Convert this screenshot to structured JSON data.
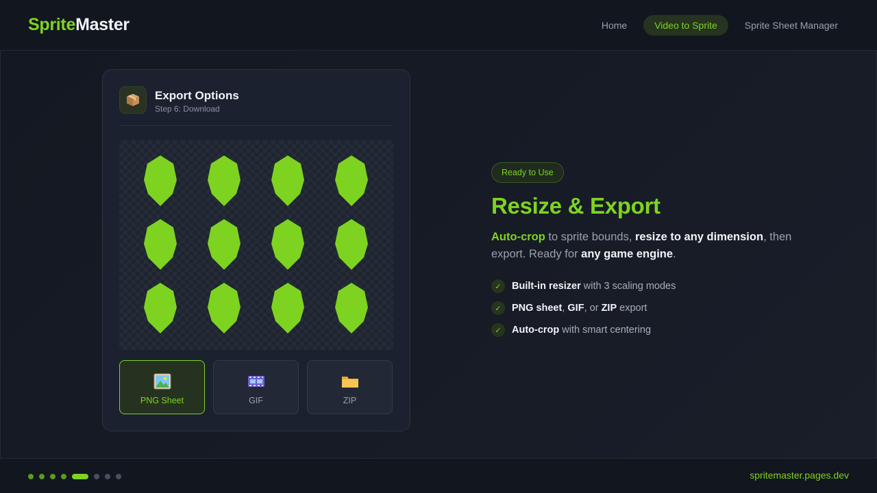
{
  "header": {
    "logo_part1": "Sprite",
    "logo_part2": "Master",
    "nav": [
      {
        "label": "Home",
        "active": false
      },
      {
        "label": "Video to Sprite",
        "active": true
      },
      {
        "label": "Sprite Sheet Manager",
        "active": false
      }
    ]
  },
  "card": {
    "icon": "package-icon",
    "title": "Export Options",
    "subtitle": "Step 6: Download",
    "sprite_grid": {
      "rows": 3,
      "cols": 4,
      "color": "#7ed321"
    },
    "export_options": [
      {
        "label": "PNG Sheet",
        "icon": "image-icon",
        "selected": true
      },
      {
        "label": "GIF",
        "icon": "film-icon",
        "selected": false
      },
      {
        "label": "ZIP",
        "icon": "folder-icon",
        "selected": false
      }
    ]
  },
  "content": {
    "badge": "Ready to Use",
    "headline": "Resize & Export",
    "desc": {
      "p1": "Auto-crop",
      "p2": " to sprite bounds, ",
      "p3": "resize to any dimension",
      "p4": ", then export. Ready for ",
      "p5": "any game engine",
      "p6": "."
    },
    "features": [
      {
        "bold": "Built-in resizer",
        "rest": " with 3 scaling modes"
      },
      {
        "bold1": "PNG sheet",
        "sep1": ", ",
        "bold2": "GIF",
        "sep2": ", or ",
        "bold3": "ZIP",
        "rest": " export"
      },
      {
        "bold": "Auto-crop",
        "rest": " with smart centering"
      }
    ]
  },
  "footer": {
    "steps_total": 8,
    "current_step": 5,
    "site": "spritemaster.pages.dev"
  },
  "colors": {
    "accent": "#7ed321",
    "background": "#131721",
    "card": "#1c2130"
  }
}
